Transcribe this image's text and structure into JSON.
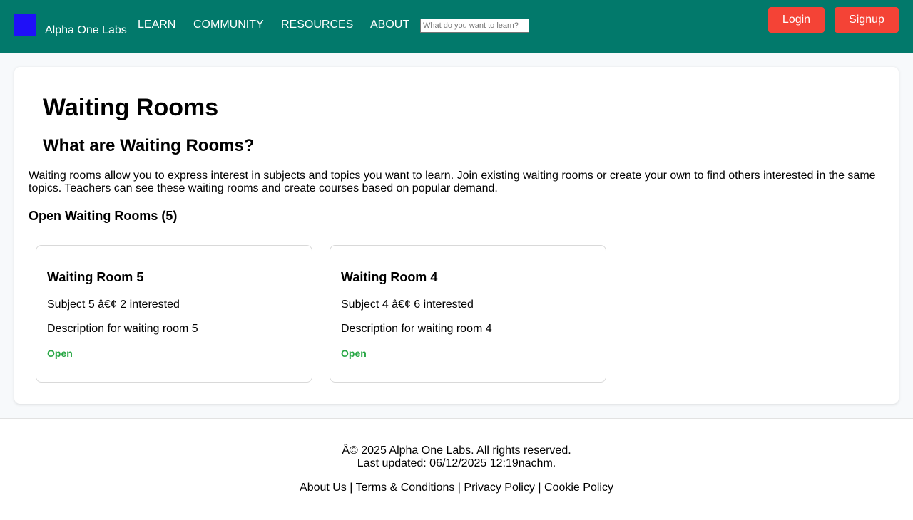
{
  "header": {
    "brand": "Alpha One Labs",
    "nav": [
      "LEARN",
      "COMMUNITY",
      "RESOURCES",
      "ABOUT"
    ],
    "search_placeholder": "What do you want to learn?",
    "login_label": "Login",
    "signup_label": "Signup"
  },
  "main": {
    "title": "Waiting Rooms",
    "subtitle": "What are Waiting Rooms?",
    "intro": "Waiting rooms allow you to express interest in subjects and topics you want to learn. Join existing waiting rooms or create your own to find others interested in the same topics. Teachers can see these waiting rooms and create courses based on popular demand.",
    "open_heading": "Open Waiting Rooms (5)",
    "rooms": [
      {
        "title": "Waiting Room 5",
        "meta": "Subject 5 â€¢ 2 interested",
        "description": "Description for waiting room 5",
        "status": "Open"
      },
      {
        "title": "Waiting Room 4",
        "meta": "Subject 4 â€¢ 6 interested",
        "description": "Description for waiting room 4",
        "status": "Open"
      }
    ]
  },
  "footer": {
    "copyright": "Â© 2025 Alpha One Labs. All rights reserved.",
    "updated": "Last updated: 06/12/2025 12:19nachm.",
    "links": [
      "About Us",
      "Terms & Conditions",
      "Privacy Policy",
      "Cookie Policy"
    ],
    "separator": " | "
  },
  "colors": {
    "header_bg": "#02796b",
    "button_bg": "#f44336",
    "logo": "#1f10f8",
    "status_open": "#28a745"
  }
}
